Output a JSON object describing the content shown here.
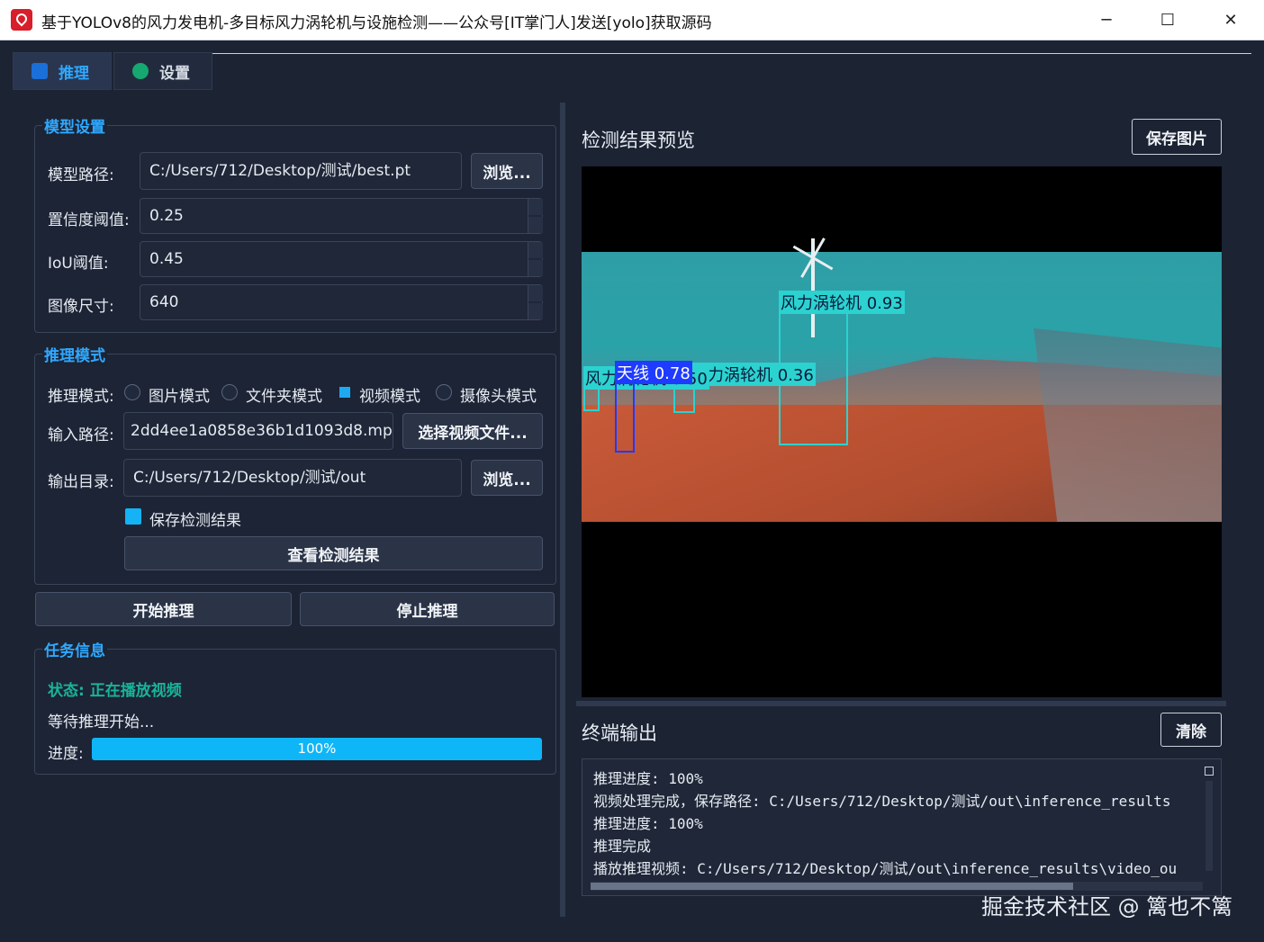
{
  "window": {
    "title": "基于YOLOv8的风力发电机-多目标风力涡轮机与设施检测——公众号[IT掌门人]发送[yolo]获取源码",
    "minimize": "─",
    "maximize": "☐",
    "close": "✕"
  },
  "tabs": [
    {
      "label": "推理",
      "icon": "chart-icon",
      "active": true
    },
    {
      "label": "设置",
      "icon": "check-icon",
      "active": false
    }
  ],
  "model_settings": {
    "title": "模型设置",
    "model_path_label": "模型路径:",
    "model_path_value": "C:/Users/712/Desktop/测试/best.pt",
    "browse_label": "浏览...",
    "conf_label": "置信度阈值:",
    "conf_value": "0.25",
    "iou_label": "IoU阈值:",
    "iou_value": "0.45",
    "imgsz_label": "图像尺寸:",
    "imgsz_value": "640"
  },
  "inference_mode": {
    "title": "推理模式",
    "mode_label": "推理模式:",
    "modes": [
      {
        "label": "图片模式",
        "checked": false
      },
      {
        "label": "文件夹模式",
        "checked": false
      },
      {
        "label": "视频模式",
        "checked": true
      },
      {
        "label": "摄像头模式",
        "checked": false
      }
    ],
    "input_label": "输入路径:",
    "input_value": "2dd4ee1a0858e36b1d1093d8.mp4",
    "select_video_label": "选择视频文件...",
    "output_label": "输出目录:",
    "output_value": "C:/Users/712/Desktop/测试/out",
    "browse_label": "浏览...",
    "save_results_label": "保存检测结果",
    "save_results_checked": true,
    "view_results_label": "查看检测结果"
  },
  "actions": {
    "start_label": "开始推理",
    "stop_label": "停止推理"
  },
  "task_info": {
    "title": "任务信息",
    "status": "状态: 正在播放视频",
    "status_color": "#19b39a",
    "message": "等待推理开始...",
    "progress_label": "进度:",
    "progress_value": 100,
    "progress_text": "100%",
    "accent_color": "#0fb6f7"
  },
  "preview": {
    "title": "检测结果预览",
    "save_label": "保存图片",
    "detections": [
      {
        "label": "风力涡轮机 0.93",
        "color": "#2bd2d0"
      },
      {
        "label": "天线 0.78",
        "color": "#1f3bff"
      },
      {
        "label": "风力涡轮机 0.36",
        "color": "#2bd2d0"
      },
      {
        "label": "风力涡轮机 0.50",
        "color": "#2bd2d0"
      }
    ]
  },
  "terminal": {
    "title": "终端输出",
    "clear_label": "清除",
    "lines": [
      "推理进度: 100%",
      "视频处理完成，保存路径: C:/Users/712/Desktop/测试/out\\inference_results",
      "推理进度: 100%",
      "推理完成",
      "播放推理视频: C:/Users/712/Desktop/测试/out\\inference_results\\video_ou"
    ]
  },
  "watermark": "掘金技术社区 @ 篱也不篱"
}
